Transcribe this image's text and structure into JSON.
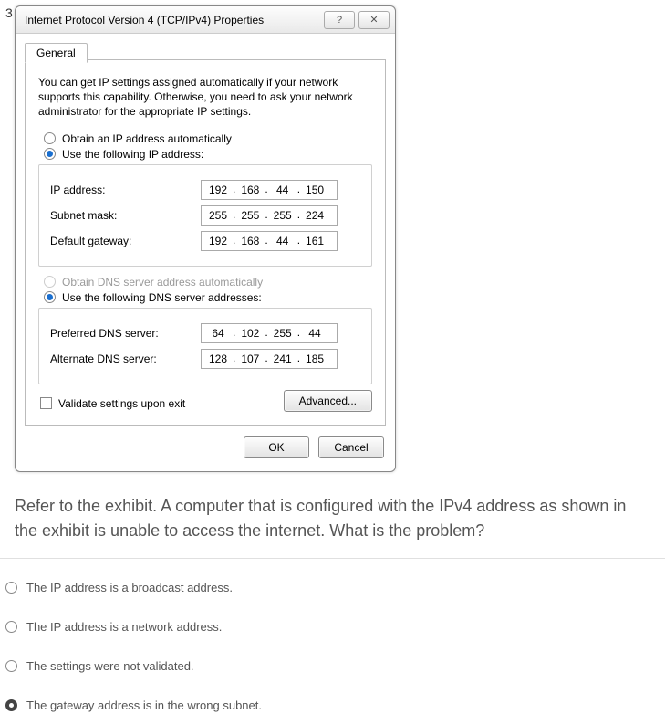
{
  "question_num": "3",
  "window": {
    "title": "Internet Protocol Version 4 (TCP/IPv4) Properties",
    "help_glyph": "?",
    "close_glyph": "✕"
  },
  "tab": {
    "label": "General"
  },
  "intro": "You can get IP settings assigned automatically if your network supports this capability. Otherwise, you need to ask your network administrator for the appropriate IP settings.",
  "ip_mode": {
    "auto_label": "Obtain an IP address automatically",
    "manual_label": "Use the following IP address:",
    "selected": "manual"
  },
  "ip_fields": {
    "ip_label": "IP address:",
    "ip": [
      "192",
      "168",
      "44",
      "150"
    ],
    "mask_label": "Subnet mask:",
    "mask": [
      "255",
      "255",
      "255",
      "224"
    ],
    "gw_label": "Default gateway:",
    "gw": [
      "192",
      "168",
      "44",
      "161"
    ]
  },
  "dns_mode": {
    "auto_label": "Obtain DNS server address automatically",
    "manual_label": "Use the following DNS server addresses:",
    "auto_enabled": false,
    "selected": "manual"
  },
  "dns_fields": {
    "pref_label": "Preferred DNS server:",
    "pref": [
      "64",
      "102",
      "255",
      "44"
    ],
    "alt_label": "Alternate DNS server:",
    "alt": [
      "128",
      "107",
      "241",
      "185"
    ]
  },
  "validate_label": "Validate settings upon exit",
  "validate_checked": false,
  "buttons": {
    "advanced": "Advanced...",
    "ok": "OK",
    "cancel": "Cancel"
  },
  "question_text": "Refer to the exhibit. A computer that is configured with the IPv4 address as shown in the exhibit is unable to access the internet. What is the problem?",
  "answers": [
    {
      "text": "The IP address is a broadcast address.",
      "selected": false
    },
    {
      "text": "The IP address is a network address.",
      "selected": false
    },
    {
      "text": "The settings were not validated.",
      "selected": false
    },
    {
      "text": "The gateway address is in the wrong subnet.",
      "selected": true
    }
  ]
}
